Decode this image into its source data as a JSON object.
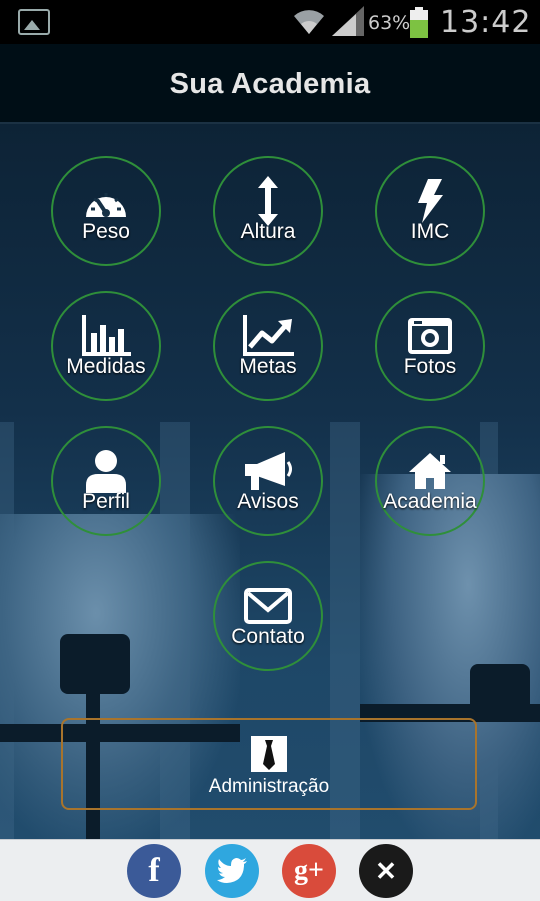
{
  "status_bar": {
    "battery_percent": "63%",
    "time": "13:42",
    "battery_level": 0.63
  },
  "header": {
    "title": "Sua Academia"
  },
  "menu": {
    "peso": "Peso",
    "altura": "Altura",
    "imc": "IMC",
    "medidas": "Medidas",
    "metas": "Metas",
    "fotos": "Fotos",
    "perfil": "Perfil",
    "avisos": "Avisos",
    "academia": "Academia",
    "contato": "Contato"
  },
  "admin": {
    "label": "Administração"
  },
  "share": {
    "facebook": "f",
    "twitter": "twitter-icon",
    "google_plus": "g+",
    "close": "✕",
    "colors": {
      "facebook": "#3b5a98",
      "twitter": "#2fa7df",
      "google_plus": "#d94b3b",
      "close": "#1a1a1a"
    }
  },
  "colors": {
    "circle_border": "#2f8f3a",
    "admin_border": "#a8742c"
  }
}
